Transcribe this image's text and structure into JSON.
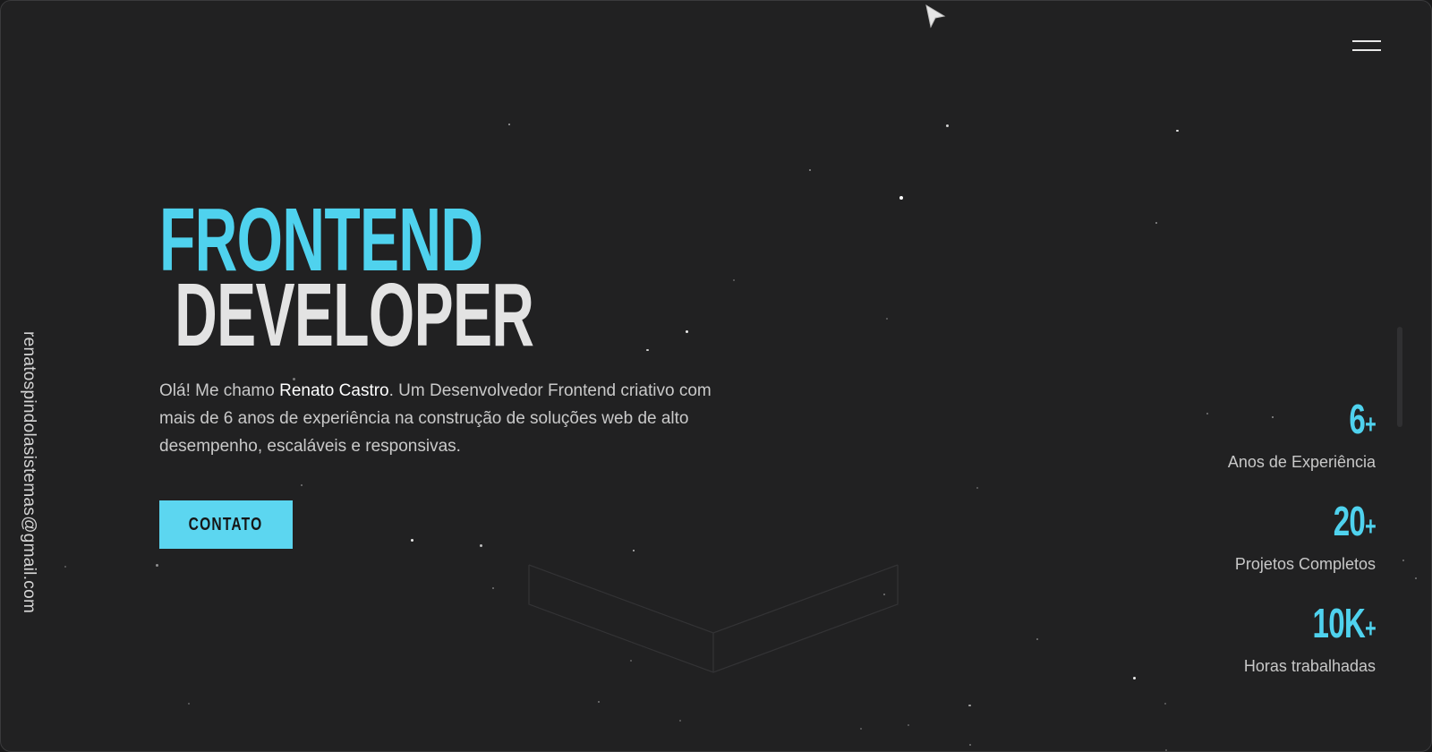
{
  "header": {
    "menu_icon": "hamburger-menu-icon"
  },
  "sidebar": {
    "email": "renatospindolasistemas@gmail.com"
  },
  "hero": {
    "title_line1": "FRONTEND",
    "title_line2": "DEVELOPER",
    "intro_prefix": "Olá! Me chamo ",
    "intro_name": "Renato Castro",
    "intro_suffix": ". Um Desenvolvedor Frontend criativo com mais de 6 anos de experiência na construção de soluções web de alto desempenho, escaláveis e responsivas.",
    "contact_label": "CONTATO"
  },
  "stats": [
    {
      "value": "6",
      "suffix": "+",
      "label": "Anos de Experiência"
    },
    {
      "value": "20",
      "suffix": "+",
      "label": "Projetos Completos"
    },
    {
      "value": "10K",
      "suffix": "+",
      "label": "Horas trabalhadas"
    }
  ],
  "colors": {
    "accent": "#4fd2ee",
    "background": "#212122",
    "text": "#c9c9c9",
    "button": "#5cd6f0"
  }
}
